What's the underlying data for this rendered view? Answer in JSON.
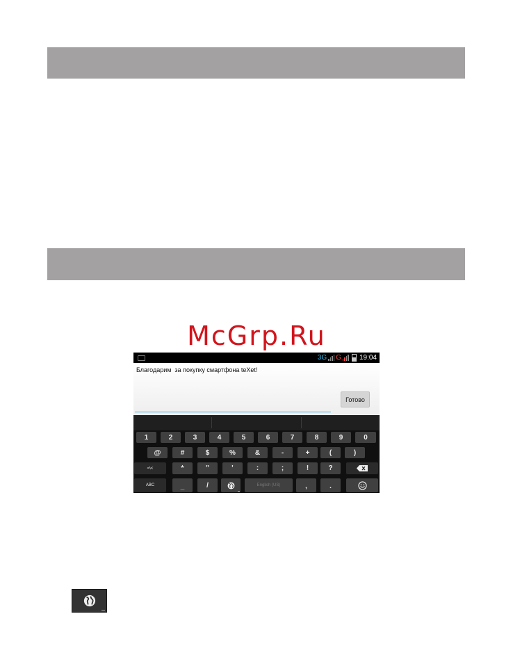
{
  "watermark": "McGrp.Ru",
  "status_bar": {
    "network_1": "3G",
    "network_2": "G",
    "time": "19:04"
  },
  "edit_field": {
    "text": "Благодарим  за покупку смартфона teXet!"
  },
  "done_button_label": "Готово",
  "keyboard": {
    "number_row": [
      "1",
      "2",
      "3",
      "4",
      "5",
      "6",
      "7",
      "8",
      "9",
      "0"
    ],
    "symbol_row_1": [
      "@",
      "#",
      "$",
      "%",
      "&",
      "-",
      "+",
      "(",
      ")"
    ],
    "symbol_row_2_shift": "=\\<",
    "symbol_row_2": [
      "*",
      "\"",
      "'",
      ":",
      ";",
      "!",
      "?"
    ],
    "abc_label": "ABC",
    "underscore": "_",
    "slash": "/",
    "space_label": "English (US)",
    "comma": ",",
    "period": ".",
    "icons": {
      "backspace": "backspace-icon",
      "language": "globe-icon",
      "emoji": "smiley-icon"
    }
  },
  "colors": {
    "section_bar": "#a3a1a2",
    "accent_blue": "#33b5e5",
    "keyboard_key": "#404040",
    "watermark": "#d2141c"
  }
}
